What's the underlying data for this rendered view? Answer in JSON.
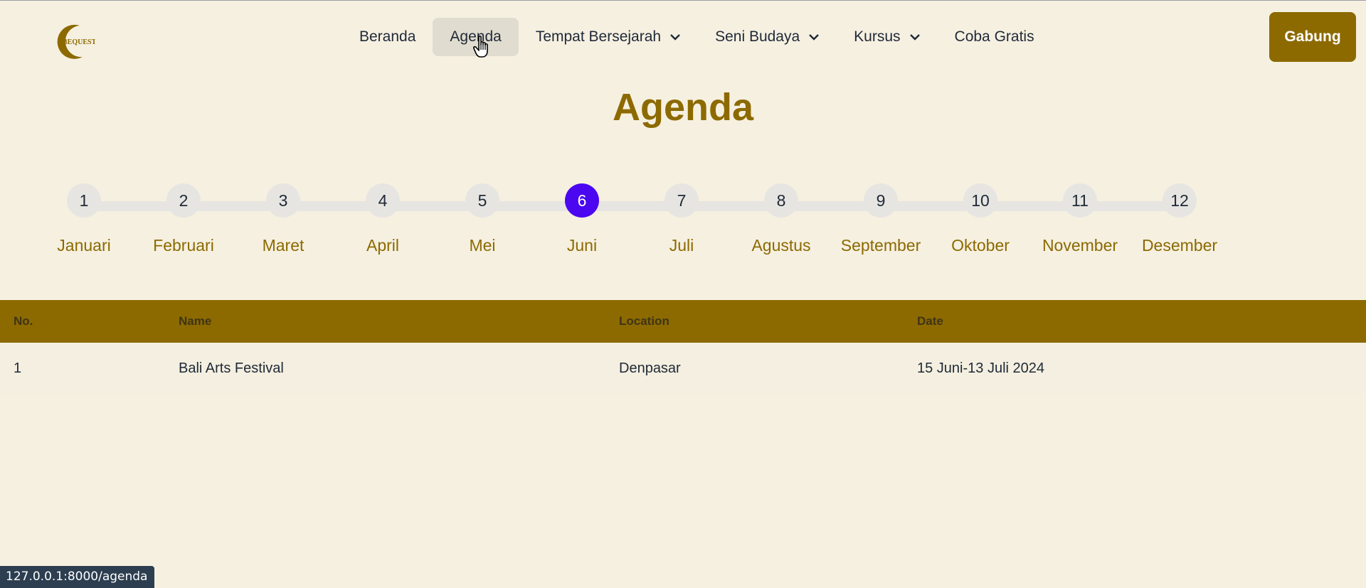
{
  "colors": {
    "brand": "#8c6a00",
    "active_step": "#4a07f0",
    "background": "#f6f0e1"
  },
  "nav": {
    "logo_text": "BEQUEST",
    "items": [
      {
        "label": "Beranda",
        "dropdown": false,
        "active": false
      },
      {
        "label": "Agenda",
        "dropdown": false,
        "active": true
      },
      {
        "label": "Tempat Bersejarah",
        "dropdown": true,
        "active": false
      },
      {
        "label": "Seni Budaya",
        "dropdown": true,
        "active": false
      },
      {
        "label": "Kursus",
        "dropdown": true,
        "active": false
      },
      {
        "label": "Coba Gratis",
        "dropdown": false,
        "active": false
      }
    ],
    "join_label": "Gabung"
  },
  "page": {
    "title": "Agenda"
  },
  "months": [
    {
      "num": "1",
      "name": "Januari"
    },
    {
      "num": "2",
      "name": "Februari"
    },
    {
      "num": "3",
      "name": "Maret"
    },
    {
      "num": "4",
      "name": "April"
    },
    {
      "num": "5",
      "name": "Mei"
    },
    {
      "num": "6",
      "name": "Juni"
    },
    {
      "num": "7",
      "name": "Juli"
    },
    {
      "num": "8",
      "name": "Agustus"
    },
    {
      "num": "9",
      "name": "September"
    },
    {
      "num": "10",
      "name": "Oktober"
    },
    {
      "num": "11",
      "name": "November"
    },
    {
      "num": "12",
      "name": "Desember"
    }
  ],
  "selected_month": "6",
  "table": {
    "headers": [
      "No.",
      "Name",
      "Location",
      "Date"
    ],
    "rows": [
      [
        "1",
        "Bali Arts Festival",
        "Denpasar",
        "15 Juni-13 Juli 2024"
      ]
    ]
  },
  "status_bar": {
    "url": "127.0.0.1:8000/agenda"
  }
}
